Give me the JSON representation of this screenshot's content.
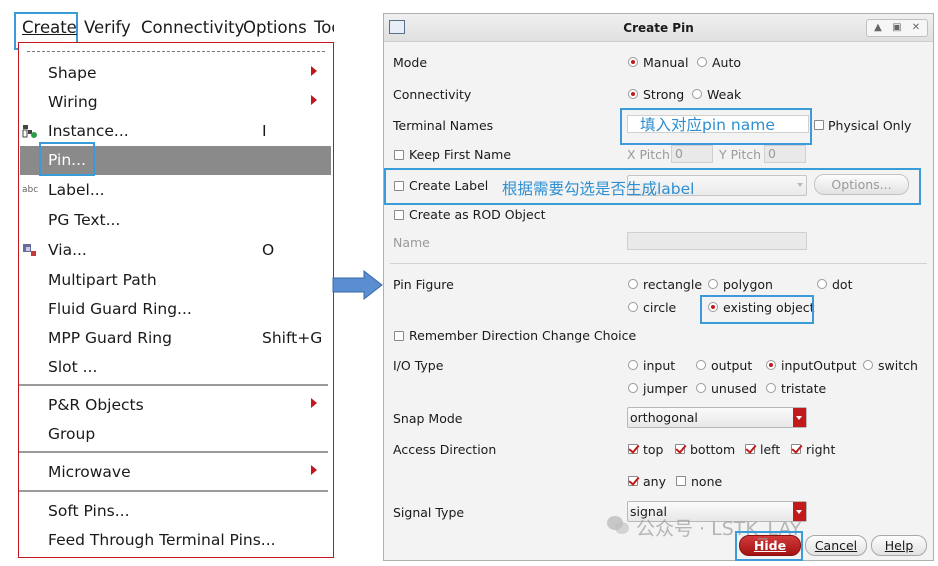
{
  "menubar": {
    "items": [
      "Create",
      "Verify",
      "Connectivity",
      "Options",
      "Tools"
    ]
  },
  "create_menu": {
    "items": [
      {
        "label": "Shape",
        "submenu": true
      },
      {
        "label": "Wiring",
        "submenu": true
      },
      {
        "label": "Instance...",
        "shortcut": "I",
        "icon": "instance-icon"
      },
      {
        "label": "Pin...",
        "selected": true
      },
      {
        "label": "Label...",
        "icon": "label-abc-icon"
      },
      {
        "label": "PG Text..."
      },
      {
        "label": "Via...",
        "shortcut": "O",
        "icon": "via-icon"
      },
      {
        "label": "Multipart Path"
      },
      {
        "label": "Fluid Guard Ring..."
      },
      {
        "label": "MPP Guard Ring",
        "shortcut": "Shift+G"
      },
      {
        "label": "Slot ..."
      },
      {
        "label": "P&R Objects",
        "submenu": true
      },
      {
        "label": "Group"
      },
      {
        "label": "Microwave",
        "submenu": true
      },
      {
        "label": "Soft Pins..."
      },
      {
        "label": "Feed Through Terminal Pins..."
      }
    ]
  },
  "dialog": {
    "title": "Create Pin",
    "window_controls": [
      "▲",
      "▣",
      "✕"
    ],
    "mode": {
      "label": "Mode",
      "options": [
        "Manual",
        "Auto"
      ],
      "selected": "Manual"
    },
    "connectivity": {
      "label": "Connectivity",
      "options": [
        "Strong",
        "Weak"
      ],
      "selected": "Strong"
    },
    "terminal_names": {
      "label": "Terminal Names",
      "value": "",
      "physical_only_label": "Physical Only",
      "physical_only": false
    },
    "keep_first_name": {
      "label": "Keep First Name",
      "checked": false,
      "x_pitch_label": "X Pitch",
      "x_pitch": "0",
      "y_pitch_label": "Y Pitch",
      "y_pitch": "0"
    },
    "create_label": {
      "label": "Create Label",
      "checked": false,
      "value": "",
      "options_button": "Options..."
    },
    "create_as_rod": {
      "label": "Create as ROD Object",
      "checked": false
    },
    "name": {
      "label": "Name",
      "value": ""
    },
    "pin_figure": {
      "label": "Pin Figure",
      "options": [
        "rectangle",
        "polygon",
        "dot",
        "circle",
        "existing object"
      ],
      "selected": "existing object"
    },
    "remember_direction": {
      "label": "Remember Direction Change Choice",
      "checked": false
    },
    "io_type": {
      "label": "I/O Type",
      "options": [
        "input",
        "output",
        "inputOutput",
        "switch",
        "jumper",
        "unused",
        "tristate"
      ],
      "selected": "inputOutput"
    },
    "snap_mode": {
      "label": "Snap Mode",
      "value": "orthogonal"
    },
    "access_direction": {
      "label": "Access Direction",
      "options": [
        {
          "label": "top",
          "checked": true
        },
        {
          "label": "bottom",
          "checked": true
        },
        {
          "label": "left",
          "checked": true
        },
        {
          "label": "right",
          "checked": true
        },
        {
          "label": "any",
          "checked": true
        },
        {
          "label": "none",
          "checked": false
        }
      ]
    },
    "signal_type": {
      "label": "Signal Type",
      "value": "signal"
    },
    "buttons": {
      "hide": "Hide",
      "cancel": "Cancel",
      "help": "Help"
    }
  },
  "annotations": {
    "terminal_note": "填入对应pin name",
    "label_note": "根据需要勾选是否生成label"
  },
  "watermark": "公众号 · LSTK_LAY",
  "colors": {
    "highlight": "#3a9bd8",
    "accent_red": "#c21a1a",
    "menu_selected": "#8a8a8a"
  }
}
